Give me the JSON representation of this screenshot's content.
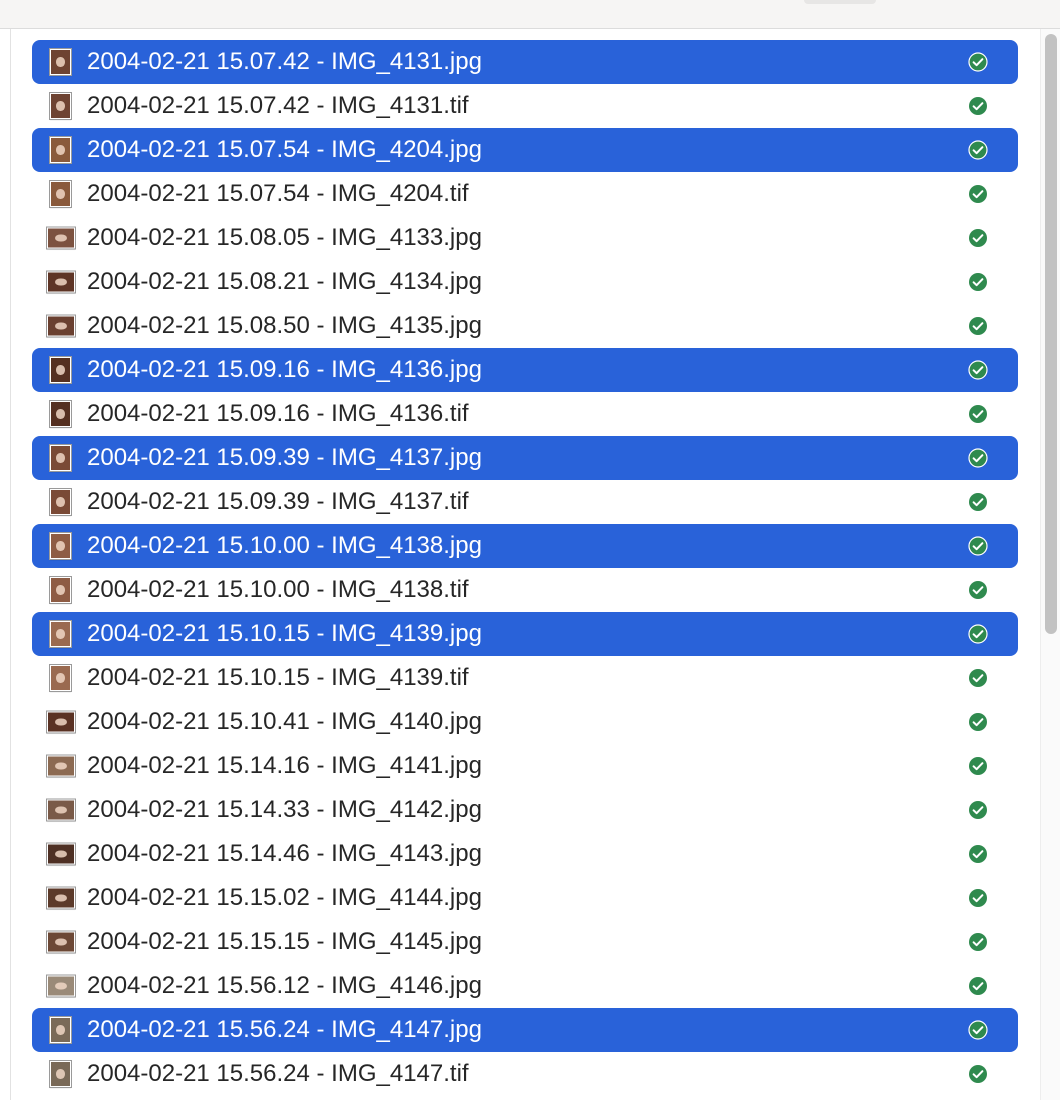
{
  "colors": {
    "selection": "#2962d9",
    "status_ok": "#2f8a4e",
    "text": "#262626"
  },
  "files": [
    {
      "name": "2004-02-21 15.07.42 - IMG_4131.jpg",
      "selected": true,
      "thumb": "portrait",
      "thumb_color": "#6e4332",
      "status": "synced-checkmark-icon"
    },
    {
      "name": "2004-02-21 15.07.42 - IMG_4131.tif",
      "selected": false,
      "thumb": "portrait",
      "thumb_color": "#6e4332",
      "status": "synced-checkmark-icon"
    },
    {
      "name": "2004-02-21 15.07.54 - IMG_4204.jpg",
      "selected": true,
      "thumb": "portrait",
      "thumb_color": "#8a5a3c",
      "status": "synced-checkmark-icon"
    },
    {
      "name": "2004-02-21 15.07.54 - IMG_4204.tif",
      "selected": false,
      "thumb": "portrait",
      "thumb_color": "#8a5a3c",
      "status": "synced-checkmark-icon"
    },
    {
      "name": "2004-02-21 15.08.05 - IMG_4133.jpg",
      "selected": false,
      "thumb": "landscape",
      "thumb_color": "#7c5240",
      "status": "synced-checkmark-icon"
    },
    {
      "name": "2004-02-21 15.08.21 - IMG_4134.jpg",
      "selected": false,
      "thumb": "landscape",
      "thumb_color": "#5e3526",
      "status": "synced-checkmark-icon"
    },
    {
      "name": "2004-02-21 15.08.50 - IMG_4135.jpg",
      "selected": false,
      "thumb": "landscape",
      "thumb_color": "#6a4030",
      "status": "synced-checkmark-icon"
    },
    {
      "name": "2004-02-21 15.09.16 - IMG_4136.jpg",
      "selected": true,
      "thumb": "portrait",
      "thumb_color": "#553021",
      "status": "synced-checkmark-icon"
    },
    {
      "name": "2004-02-21 15.09.16 - IMG_4136.tif",
      "selected": false,
      "thumb": "portrait",
      "thumb_color": "#553021",
      "status": "synced-checkmark-icon"
    },
    {
      "name": "2004-02-21 15.09.39 - IMG_4137.jpg",
      "selected": true,
      "thumb": "portrait",
      "thumb_color": "#7a4a36",
      "status": "synced-checkmark-icon"
    },
    {
      "name": "2004-02-21 15.09.39 - IMG_4137.tif",
      "selected": false,
      "thumb": "portrait",
      "thumb_color": "#7a4a36",
      "status": "synced-checkmark-icon"
    },
    {
      "name": "2004-02-21 15.10.00 - IMG_4138.jpg",
      "selected": true,
      "thumb": "portrait",
      "thumb_color": "#8e5c44",
      "status": "synced-checkmark-icon"
    },
    {
      "name": "2004-02-21 15.10.00 - IMG_4138.tif",
      "selected": false,
      "thumb": "portrait",
      "thumb_color": "#8e5c44",
      "status": "synced-checkmark-icon"
    },
    {
      "name": "2004-02-21 15.10.15 - IMG_4139.jpg",
      "selected": true,
      "thumb": "portrait",
      "thumb_color": "#9a6a50",
      "status": "synced-checkmark-icon"
    },
    {
      "name": "2004-02-21 15.10.15 - IMG_4139.tif",
      "selected": false,
      "thumb": "portrait",
      "thumb_color": "#9a6a50",
      "status": "synced-checkmark-icon"
    },
    {
      "name": "2004-02-21 15.10.41 - IMG_4140.jpg",
      "selected": false,
      "thumb": "landscape",
      "thumb_color": "#5a3224",
      "status": "synced-checkmark-icon"
    },
    {
      "name": "2004-02-21 15.14.16 - IMG_4141.jpg",
      "selected": false,
      "thumb": "landscape",
      "thumb_color": "#8c6a52",
      "status": "synced-checkmark-icon"
    },
    {
      "name": "2004-02-21 15.14.33 - IMG_4142.jpg",
      "selected": false,
      "thumb": "landscape",
      "thumb_color": "#7a5a48",
      "status": "synced-checkmark-icon"
    },
    {
      "name": "2004-02-21 15.14.46 - IMG_4143.jpg",
      "selected": false,
      "thumb": "landscape",
      "thumb_color": "#4e3024",
      "status": "synced-checkmark-icon"
    },
    {
      "name": "2004-02-21 15.15.02 - IMG_4144.jpg",
      "selected": false,
      "thumb": "landscape",
      "thumb_color": "#5c3a2a",
      "status": "synced-checkmark-icon"
    },
    {
      "name": "2004-02-21 15.15.15 - IMG_4145.jpg",
      "selected": false,
      "thumb": "landscape",
      "thumb_color": "#6c4836",
      "status": "synced-checkmark-icon"
    },
    {
      "name": "2004-02-21 15.56.12 - IMG_4146.jpg",
      "selected": false,
      "thumb": "landscape",
      "thumb_color": "#9a8a78",
      "status": "synced-checkmark-icon"
    },
    {
      "name": "2004-02-21 15.56.24 - IMG_4147.jpg",
      "selected": true,
      "thumb": "portrait",
      "thumb_color": "#7a6a58",
      "status": "synced-checkmark-icon"
    },
    {
      "name": "2004-02-21 15.56.24 - IMG_4147.tif",
      "selected": false,
      "thumb": "portrait",
      "thumb_color": "#7a6a58",
      "status": "synced-checkmark-icon"
    }
  ]
}
